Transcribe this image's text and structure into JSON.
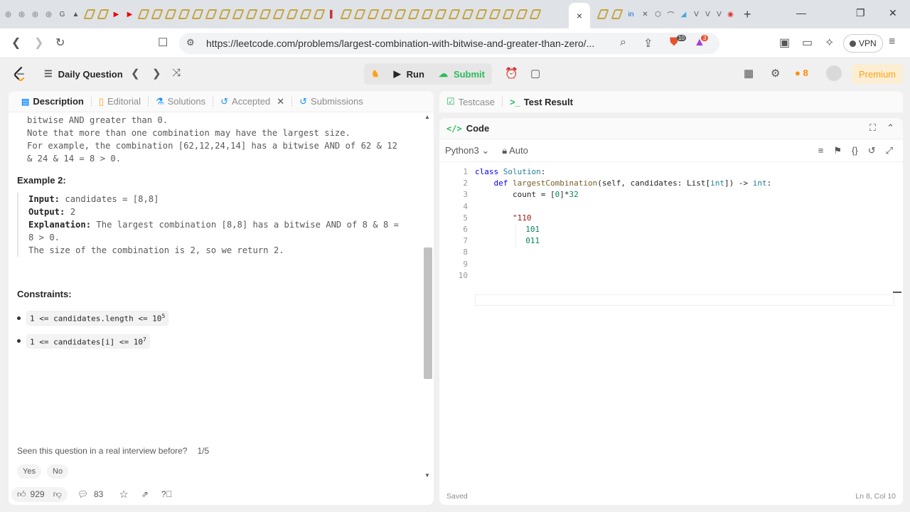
{
  "browser": {
    "active_tab_close": "×",
    "new_tab": "+",
    "url": "https://leetcode.com/problems/largest-combination-with-bitwise-and-greater-than-zero/...",
    "vpn_label": "VPN",
    "brave_badge": "10",
    "alert_badge": "3"
  },
  "nav": {
    "daily_question": "Daily Question",
    "run": "Run",
    "submit": "Submit",
    "streak": "8",
    "premium": "Premium"
  },
  "left_tabs": [
    "Description",
    "Editorial",
    "Solutions",
    "Accepted",
    "Submissions"
  ],
  "description": {
    "lines_top": [
      "bitwise AND greater than 0.",
      "Note that more than one combination may have the largest size.",
      "For example, the combination [62,12,24,14] has a bitwise AND of 62 & 12",
      "& 24 & 14 = 8 > 0."
    ],
    "example2_title": "Example 2:",
    "input_label": "Input:",
    "input_value": "candidates = [8,8]",
    "output_label": "Output:",
    "output_value": "2",
    "explanation_label": "Explanation:",
    "explanation_line1": "The largest combination [8,8] has a bitwise AND of 8 & 8 =",
    "explanation_line2": "8 > 0.",
    "explanation_line3": "The size of the combination is 2, so we return 2.",
    "constraints_title": "Constraints:",
    "constraint1": "1 <= candidates.length <= 10",
    "constraint1_exp": "5",
    "constraint2": "1 <= candidates[i] <= 10",
    "constraint2_exp": "7",
    "interview_question": "Seen this question in a real interview before?",
    "interview_page": "1/5",
    "yes": "Yes",
    "no": "No",
    "likes": "929",
    "comments": "83"
  },
  "right_tabs": [
    "Testcase",
    "Test Result"
  ],
  "code_panel": {
    "title": "Code",
    "language": "Python3",
    "mode": "Auto",
    "line_numbers": [
      "1",
      "2",
      "3",
      "4",
      "5",
      "6",
      "7",
      "8",
      "9",
      "10"
    ],
    "status": "Saved",
    "cursor": "Ln 8, Col 10"
  },
  "colors": {
    "accent_green": "#2cbb5d",
    "premium_orange": "#ffa116",
    "link_blue": "#1a90ff"
  }
}
